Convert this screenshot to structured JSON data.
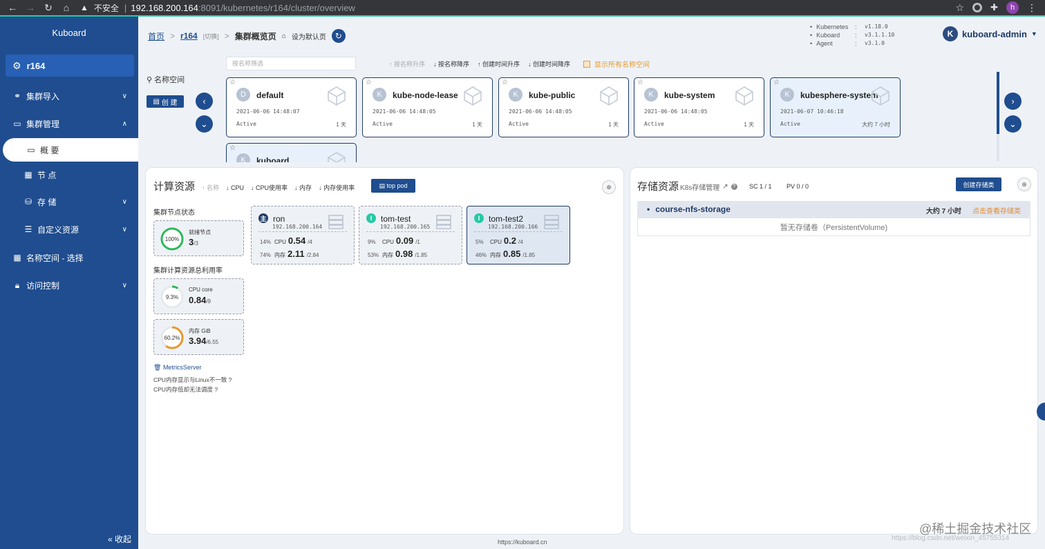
{
  "browser": {
    "security_label": "不安全",
    "url_host": "192.168.200.164",
    "url_path": ":8091/kubernetes/r164/cluster/overview",
    "profile_initial": "h"
  },
  "sidebar": {
    "logo": "Kuboard",
    "cluster_name": "r164",
    "items": [
      {
        "label": "集群导入"
      },
      {
        "label": "集群管理"
      },
      {
        "label": "概 要"
      },
      {
        "label": "节 点"
      },
      {
        "label": "存 储"
      },
      {
        "label": "自定义资源"
      },
      {
        "label": "名称空间 - 选择"
      },
      {
        "label": "访问控制"
      }
    ],
    "collapse_label": "« 收起"
  },
  "header": {
    "breadcrumb_home": "首页",
    "breadcrumb_cluster": "r164",
    "breadcrumb_switch": "[切换]",
    "breadcrumb_current": "集群概览页",
    "set_default": "设为默认页",
    "versions": [
      {
        "name": "Kubernetes",
        "value": "v1.18.0"
      },
      {
        "name": "Kuboard",
        "value": "v3.1.1.10"
      },
      {
        "name": "Agent",
        "value": "v3.1.0"
      }
    ],
    "user_initial": "K",
    "user_name": "kuboard-admin"
  },
  "namespaces": {
    "label": "名称空间",
    "create_button": "创 建",
    "filter_placeholder": "按名称筛选",
    "sort_options": [
      "↑ 按名称升序",
      "↓ 按名称降序",
      "↑ 创建时间升序",
      "↓ 创建时间降序"
    ],
    "show_all_label": "显示所有名称空间",
    "cards": [
      {
        "initial": "D",
        "name": "default",
        "time": "2021-06-06 14:48:07",
        "status": "Active",
        "age": "1 天"
      },
      {
        "initial": "K",
        "name": "kube-node-lease",
        "time": "2021-06-06 14:48:05",
        "status": "Active",
        "age": "1 天"
      },
      {
        "initial": "K",
        "name": "kube-public",
        "time": "2021-06-06 14:48:05",
        "status": "Active",
        "age": "1 天"
      },
      {
        "initial": "K",
        "name": "kube-system",
        "time": "2021-06-06 14:48:05",
        "status": "Active",
        "age": "1 天"
      },
      {
        "initial": "K",
        "name": "kubesphere-system",
        "time": "2021-06-07 10:46:18",
        "status": "Active",
        "age": "大约 7 小时"
      },
      {
        "initial": "K",
        "name": "kuboard"
      }
    ]
  },
  "compute": {
    "title": "计算资源",
    "sort_options": [
      "↑ 名称",
      "↓ CPU",
      "↓ CPU使用率",
      "↓ 内存",
      "↓ 内存使用率"
    ],
    "top_pod": "top pod",
    "node_status_label": "集群节点状态",
    "ready_label": "就绪节点",
    "ready_pct": "100%",
    "ready_value": "3",
    "ready_total": "/3",
    "usage_label": "集群计算资源总利用率",
    "cpu_label": "CPU core",
    "cpu_pct": "9.3%",
    "cpu_value": "0.84",
    "cpu_total": "/9",
    "mem_label": "内存 GiB",
    "mem_pct": "60.2%",
    "mem_value": "3.94",
    "mem_total": "/6.55",
    "nodes": [
      {
        "role": "主",
        "name": "ron",
        "ip": "192.168.200.164",
        "cpu_pct": "14%",
        "cpu_label": "CPU",
        "cpu_val": "0.54",
        "cpu_total": "/4",
        "mem_pct": "74%",
        "mem_label": "内存",
        "mem_val": "2.11",
        "mem_total": "/2.84"
      },
      {
        "role": "I",
        "name": "tom-test",
        "ip": "192.168.200.165",
        "cpu_pct": "9%",
        "cpu_label": "CPU",
        "cpu_val": "0.09",
        "cpu_total": "/1",
        "mem_pct": "53%",
        "mem_label": "内存",
        "mem_val": "0.98",
        "mem_total": "/1.85"
      },
      {
        "role": "I",
        "name": "tom-test2",
        "ip": "192.168.200.166",
        "cpu_pct": "5%",
        "cpu_label": "CPU",
        "cpu_val": "0.2",
        "cpu_total": "/4",
        "mem_pct": "46%",
        "mem_label": "内存",
        "mem_val": "0.85",
        "mem_total": "/1.85"
      }
    ],
    "metrics_server": "MetricsServer",
    "note1": "CPU内存显示与Linux不一致",
    "note2": "CPU内存低却无法调度"
  },
  "storage": {
    "title": "存储资源",
    "sub_link": "K8s存储管理",
    "sc_count": "SC 1 / 1",
    "pv_count": "PV 0 / 0",
    "create_button": "创建存储类",
    "class_name": "course-nfs-storage",
    "class_age": "大约 7 小时",
    "class_link": "点击查看存储类",
    "empty_text": "暂无存储卷（PersistentVolume)"
  },
  "footer": "https://kuboard.cn",
  "watermark": "@稀土掘金技术社区",
  "watermark_sub": "https://blog.csdn.net/weixin_45755314",
  "colors": {
    "primary": "#1f4d8f",
    "accent": "#e6882d",
    "success": "#27c9a5"
  }
}
